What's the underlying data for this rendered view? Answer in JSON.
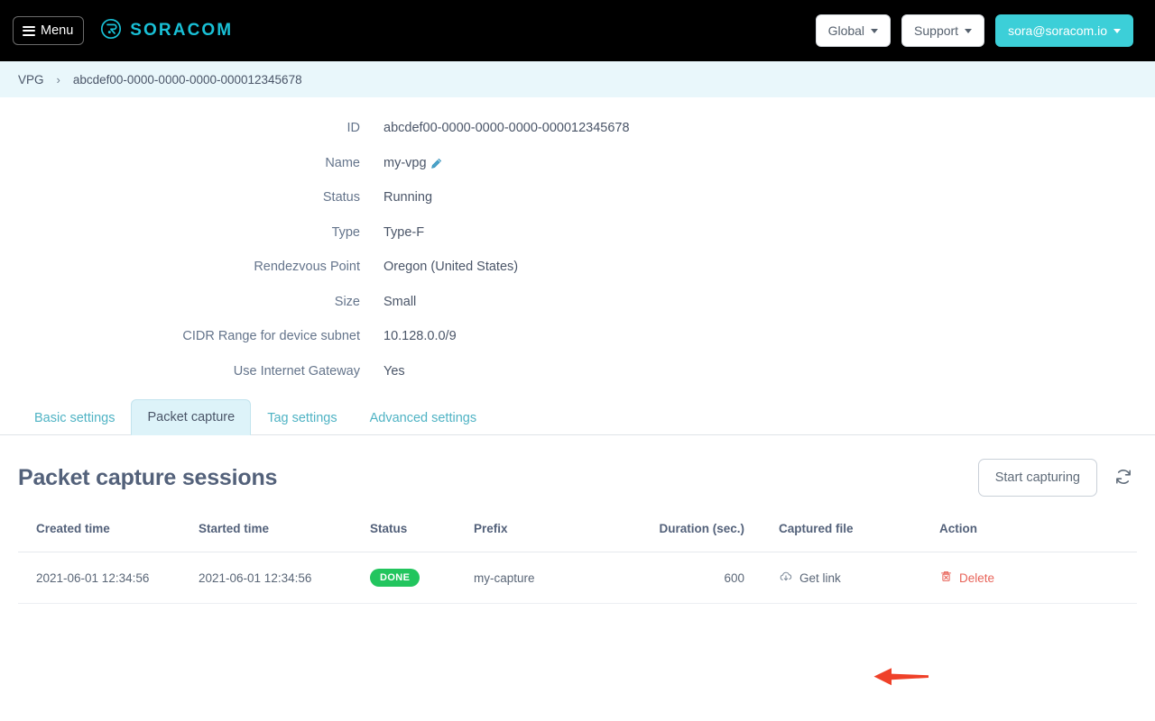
{
  "navbar": {
    "menu_label": "Menu",
    "menu_icon": "hamburger-icon",
    "brand": "SORACOM",
    "brand_icon": "soracom-logo-icon",
    "brand_color": "#19c0d6",
    "region_label": "Global",
    "support_label": "Support",
    "account_label": "sora@soracom.io",
    "account_color": "#3ccfd8",
    "background": "#000000"
  },
  "breadcrumb": {
    "root": "VPG",
    "separator": "›",
    "current": "abcdef00-0000-0000-0000-000012345678",
    "background": "#e9f7fb"
  },
  "details": {
    "rows": [
      {
        "label": "ID",
        "value": "abcdef00-0000-0000-0000-000012345678",
        "editable": false
      },
      {
        "label": "Name",
        "value": "my-vpg",
        "editable": true,
        "edit_icon": "pencil-icon"
      },
      {
        "label": "Status",
        "value": "Running",
        "editable": false
      },
      {
        "label": "Type",
        "value": "Type-F",
        "editable": false
      },
      {
        "label": "Rendezvous Point",
        "value": "Oregon (United States)",
        "editable": false
      },
      {
        "label": "Size",
        "value": "Small",
        "editable": false
      },
      {
        "label": "CIDR Range for device subnet",
        "value": "10.128.0.0/9",
        "editable": false
      },
      {
        "label": "Use Internet Gateway",
        "value": "Yes",
        "editable": false
      }
    ]
  },
  "tabs": {
    "items": [
      {
        "label": "Basic settings",
        "active": false
      },
      {
        "label": "Packet capture",
        "active": true
      },
      {
        "label": "Tag settings",
        "active": false
      },
      {
        "label": "Advanced settings",
        "active": false
      }
    ],
    "active_background": "#ddf3f9",
    "inactive_color": "#4fb3c4"
  },
  "section": {
    "title": "Packet capture sessions",
    "start_button": "Start capturing",
    "refresh_icon": "refresh-icon"
  },
  "table": {
    "headers": [
      "Created time",
      "Started time",
      "Status",
      "Prefix",
      "Duration (sec.)",
      "Captured file",
      "Action"
    ],
    "rows": [
      {
        "created_time": "2021-06-01 12:34:56",
        "started_time": "2021-06-01 12:34:56",
        "status": "DONE",
        "status_color": "#22c55e",
        "prefix": "my-capture",
        "duration": "600",
        "captured_file_label": "Get link",
        "captured_file_icon": "cloud-download-icon",
        "action_label": "Delete",
        "action_icon": "trash-icon",
        "action_color": "#e8645a"
      }
    ]
  },
  "annotation": {
    "arrow_icon": "left-arrow-annotation-icon",
    "arrow_color": "#ef4129",
    "points_at": "Get link"
  }
}
